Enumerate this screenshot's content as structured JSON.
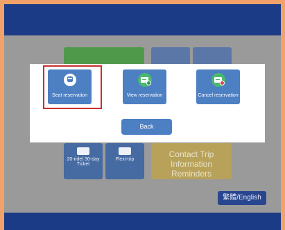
{
  "background_tiles": {
    "ticket_label": "20-ride/ 30-day Ticket",
    "flexi_label": "Flexi-trip",
    "contact_label": "Contact Trip Information Reminders"
  },
  "language_button": "繁體/English",
  "dialog": {
    "options": [
      {
        "label": "Seat reservation",
        "icon": "bus-icon",
        "highlighted": true
      },
      {
        "label": "View reservation",
        "icon": "view-reservation-icon"
      },
      {
        "label": "Cancel reservation",
        "icon": "cancel-reservation-icon"
      }
    ],
    "back_label": "Back"
  },
  "colors": {
    "header": "#1b3b86",
    "button": "#4d7fc3",
    "highlight": "#c8302f",
    "frame": "#f2a268"
  }
}
